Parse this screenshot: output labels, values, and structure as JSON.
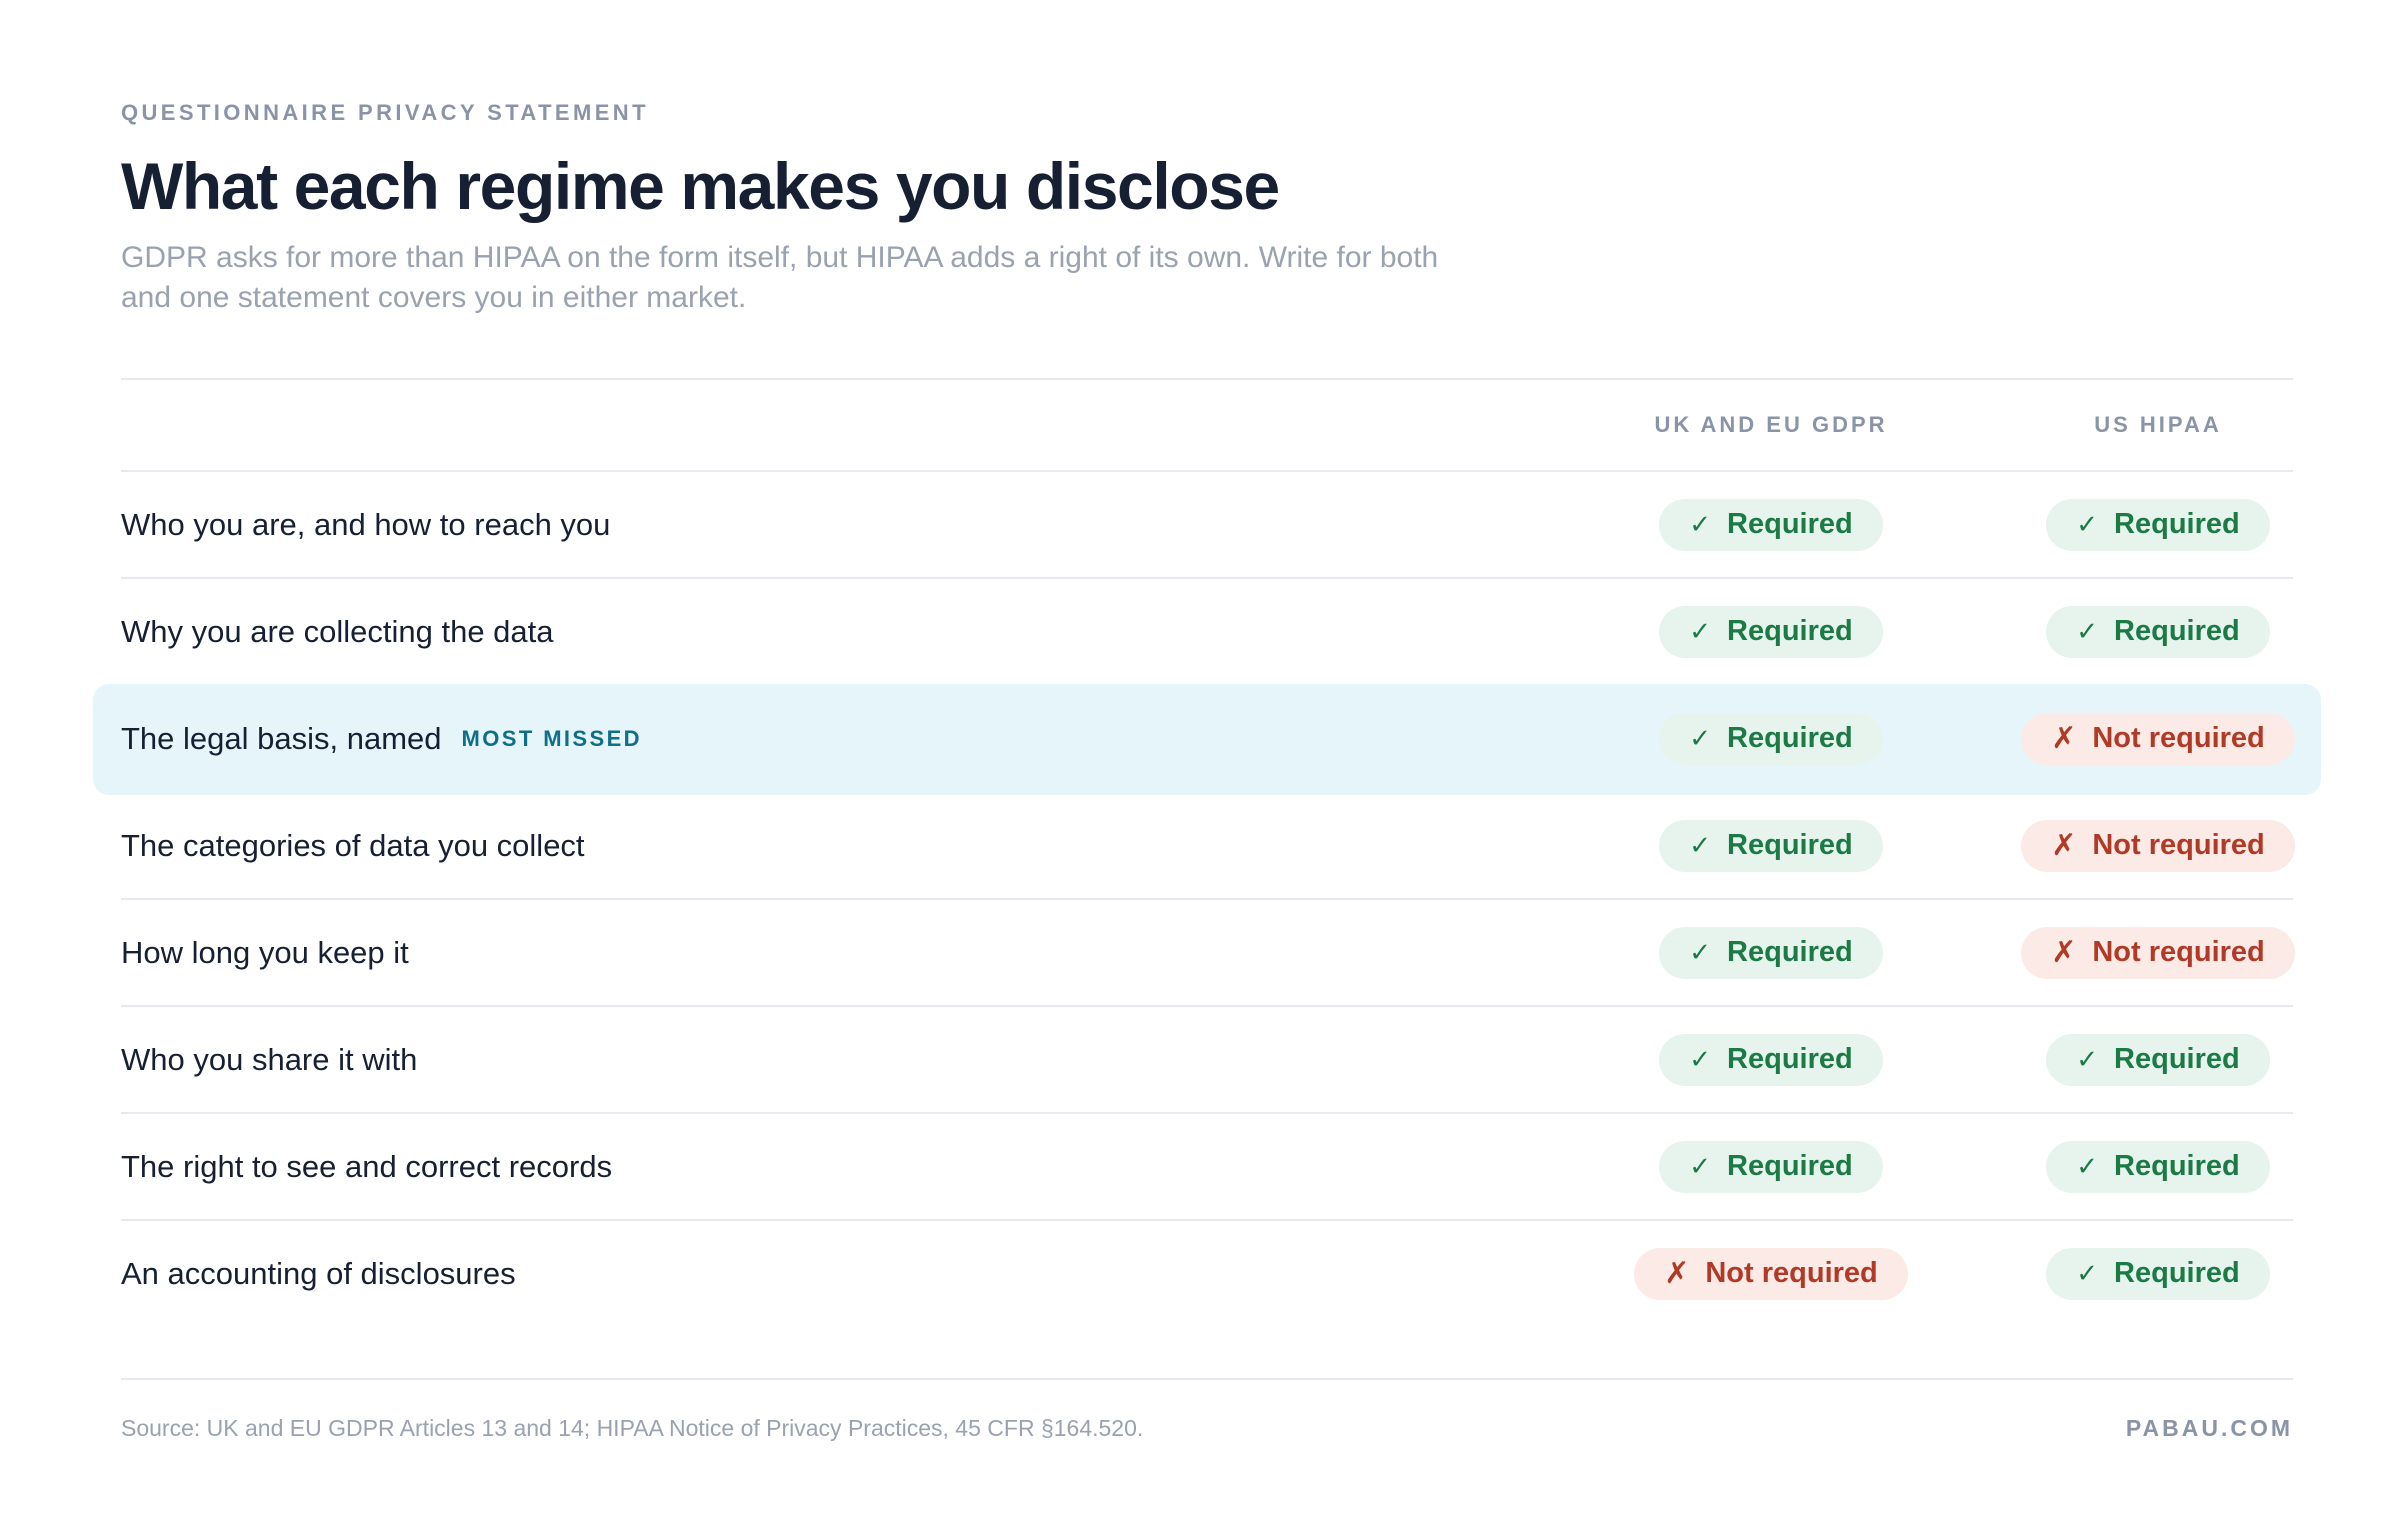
{
  "header": {
    "eyebrow": "QUESTIONNAIRE PRIVACY STATEMENT",
    "title": "What each regime makes you disclose",
    "subtitle": "GDPR asks for more than HIPAA on the form itself, but HIPAA adds a right of its own. Write for both and one statement covers you in either market."
  },
  "table": {
    "columns": [
      "UK AND EU GDPR",
      "US HIPAA"
    ],
    "rows": [
      {
        "label": "Who you are, and how to reach you",
        "tag": "",
        "gdpr": "Required",
        "hipaa": "Required",
        "gdpr_mark": "✓",
        "hipaa_mark": "✓"
      },
      {
        "label": "Why you are collecting the data",
        "tag": "",
        "gdpr": "Required",
        "hipaa": "Required",
        "gdpr_mark": "✓",
        "hipaa_mark": "✓"
      },
      {
        "label": "The legal basis, named",
        "tag": "MOST MISSED",
        "gdpr": "Required",
        "hipaa": "Not required",
        "gdpr_mark": "✓",
        "hipaa_mark": "✗"
      },
      {
        "label": "The categories of data you collect",
        "tag": "",
        "gdpr": "Required",
        "hipaa": "Not required",
        "gdpr_mark": "✓",
        "hipaa_mark": "✗"
      },
      {
        "label": "How long you keep it",
        "tag": "",
        "gdpr": "Required",
        "hipaa": "Not required",
        "gdpr_mark": "✓",
        "hipaa_mark": "✗"
      },
      {
        "label": "Who you share it with",
        "tag": "",
        "gdpr": "Required",
        "hipaa": "Required",
        "gdpr_mark": "✓",
        "hipaa_mark": "✓"
      },
      {
        "label": "The right to see and correct records",
        "tag": "",
        "gdpr": "Required",
        "hipaa": "Required",
        "gdpr_mark": "✓",
        "hipaa_mark": "✓"
      },
      {
        "label": "An accounting of disclosures",
        "tag": "",
        "gdpr": "Not required",
        "hipaa": "Required",
        "gdpr_mark": "✗",
        "hipaa_mark": "✓"
      }
    ]
  },
  "footer": {
    "source": "Source: UK and EU GDPR Articles 13 and 14; HIPAA Notice of Privacy Practices, 45 CFR §164.520.",
    "brand": "PABAU.COM"
  },
  "colors": {
    "required_text": "#1b7a45",
    "required_bg": "#e7f4ee",
    "not_required_text": "#b03a26",
    "not_required_bg": "#fbeae6",
    "highlight_bg": "#e5f5f9",
    "tag": "#0f6e8a"
  },
  "icons": {
    "required": "check-icon",
    "not_required": "cross-icon"
  }
}
